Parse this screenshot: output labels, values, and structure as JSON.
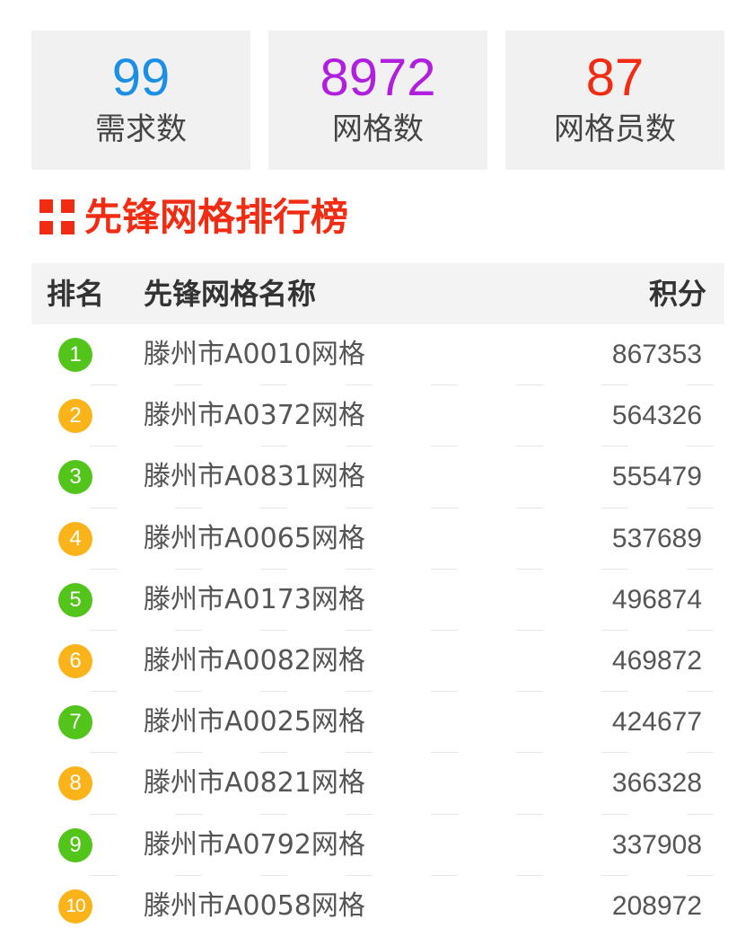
{
  "stats": [
    {
      "value": "99",
      "label": "需求数",
      "color": "#1b8fe3"
    },
    {
      "value": "8972",
      "label": "网格数",
      "color": "#b01ede"
    },
    {
      "value": "87",
      "label": "网格员数",
      "color": "#f22c12"
    }
  ],
  "section": {
    "title": "先锋网格排行榜",
    "title_color": "#f22c12",
    "icon": "grid-squares-icon"
  },
  "table": {
    "headers": {
      "rank": "排名",
      "name": "先锋网格名称",
      "score": "积分"
    },
    "rows": [
      {
        "rank": "1",
        "name": "滕州市A0010网格",
        "score": "867353",
        "badge_color": "green"
      },
      {
        "rank": "2",
        "name": "滕州市A0372网格",
        "score": "564326",
        "badge_color": "orange"
      },
      {
        "rank": "3",
        "name": "滕州市A0831网格",
        "score": "555479",
        "badge_color": "green"
      },
      {
        "rank": "4",
        "name": "滕州市A0065网格",
        "score": "537689",
        "badge_color": "orange"
      },
      {
        "rank": "5",
        "name": "滕州市A0173网格",
        "score": "496874",
        "badge_color": "green"
      },
      {
        "rank": "6",
        "name": "滕州市A0082网格",
        "score": "469872",
        "badge_color": "orange"
      },
      {
        "rank": "7",
        "name": "滕州市A0025网格",
        "score": "424677",
        "badge_color": "green"
      },
      {
        "rank": "8",
        "name": "滕州市A0821网格",
        "score": "366328",
        "badge_color": "orange"
      },
      {
        "rank": "9",
        "name": "滕州市A0792网格",
        "score": "337908",
        "badge_color": "green"
      },
      {
        "rank": "10",
        "name": "滕州市A0058网格",
        "score": "208972",
        "badge_color": "orange"
      }
    ]
  }
}
